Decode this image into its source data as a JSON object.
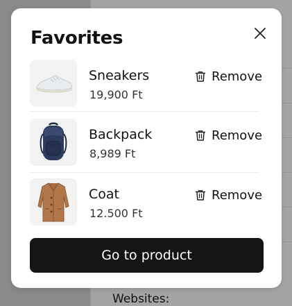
{
  "modal": {
    "title": "Favorites",
    "close_icon": "close-icon",
    "items": [
      {
        "name": "Sneakers",
        "price": "19,900 Ft",
        "image_icon": "sneakers-image",
        "remove_label": "Remove"
      },
      {
        "name": "Backpack",
        "price": "8,989 Ft",
        "image_icon": "backpack-image",
        "remove_label": "Remove"
      },
      {
        "name": "Coat",
        "price": "12.500 Ft",
        "image_icon": "coat-image",
        "remove_label": "Remove"
      }
    ],
    "primary_button": "Go to product"
  },
  "background": {
    "section_label": "Websites:"
  },
  "colors": {
    "overlay": "#8a8a8a",
    "modal_bg": "#ffffff",
    "button_bg": "#141414",
    "thumb_bg": "#f2f2f3"
  }
}
